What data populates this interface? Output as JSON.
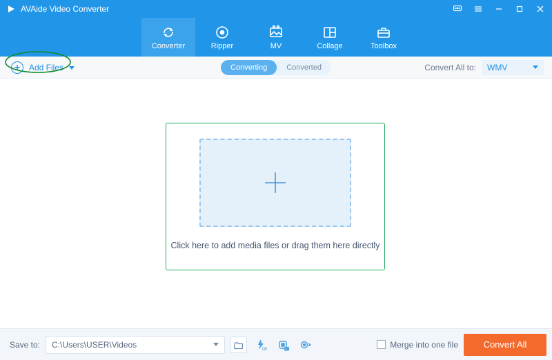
{
  "app": {
    "title": "AVAide Video Converter"
  },
  "tabs": [
    {
      "label": "Converter",
      "active": true
    },
    {
      "label": "Ripper",
      "active": false
    },
    {
      "label": "MV",
      "active": false
    },
    {
      "label": "Collage",
      "active": false
    },
    {
      "label": "Toolbox",
      "active": false
    }
  ],
  "subbar": {
    "add_files": "Add Files",
    "seg_converting": "Converting",
    "seg_converted": "Converted",
    "convert_all_to_label": "Convert All to:",
    "format_selected": "WMV"
  },
  "dropzone": {
    "hint": "Click here to add media files or drag them here directly"
  },
  "bottom": {
    "save_to_label": "Save to:",
    "save_to_path": "C:\\Users\\USER\\Videos",
    "merge_label": "Merge into one file",
    "convert_all_button": "Convert All"
  }
}
